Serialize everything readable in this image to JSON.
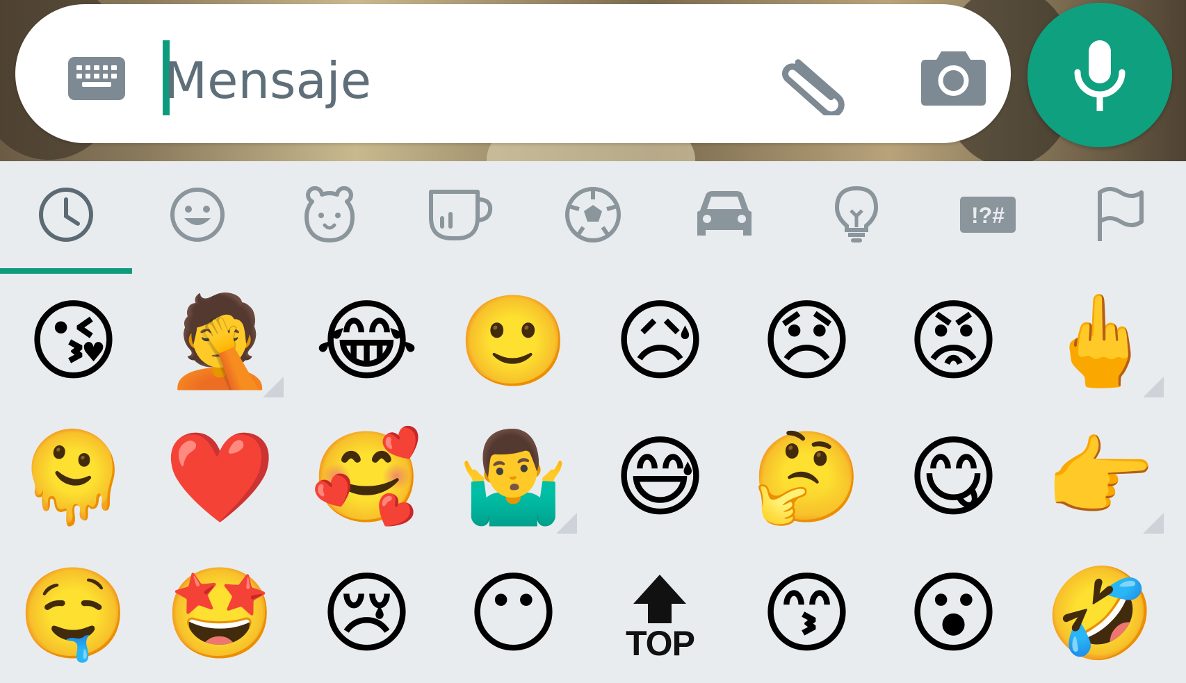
{
  "input": {
    "placeholder": "Mensaje",
    "value": ""
  },
  "icons": {
    "keyboard": "keyboard-icon",
    "attach": "paperclip-icon",
    "camera": "camera-icon",
    "mic": "microphone-icon"
  },
  "colors": {
    "accent": "#0d9b7e",
    "mic_bg": "#0fa07f",
    "icon_gray": "#6e7b84",
    "panel_bg": "#e9ecef"
  },
  "tabs": [
    {
      "name": "recent",
      "icon": "clock-icon",
      "selected": true
    },
    {
      "name": "smileys",
      "icon": "smiley-icon"
    },
    {
      "name": "animals",
      "icon": "bear-icon"
    },
    {
      "name": "food",
      "icon": "cup-icon"
    },
    {
      "name": "activity",
      "icon": "soccer-ball-icon"
    },
    {
      "name": "travel",
      "icon": "car-icon"
    },
    {
      "name": "objects",
      "icon": "lightbulb-icon"
    },
    {
      "name": "symbols",
      "icon": "symbols-icon",
      "label": "!?#"
    },
    {
      "name": "flags",
      "icon": "flag-icon"
    }
  ],
  "emojis": [
    {
      "char": "😘",
      "name": "face-blowing-kiss"
    },
    {
      "char": "🤦",
      "name": "person-facepalming",
      "variants": true
    },
    {
      "char": "😂",
      "name": "face-with-tears-of-joy"
    },
    {
      "char": "🙂",
      "name": "slightly-smiling-face"
    },
    {
      "char": "😥",
      "name": "sad-but-relieved-face"
    },
    {
      "char": "😞",
      "name": "disappointed-face"
    },
    {
      "char": "😡",
      "name": "pouting-face"
    },
    {
      "char": "🖕",
      "name": "middle-finger",
      "variants": true
    },
    {
      "char": "🫠",
      "name": "melting-face"
    },
    {
      "char": "❤️",
      "name": "red-heart"
    },
    {
      "char": "🥰",
      "name": "smiling-face-with-hearts"
    },
    {
      "char": "🤷‍♂️",
      "name": "man-shrugging",
      "variants": true
    },
    {
      "char": "😅",
      "name": "grinning-face-with-sweat"
    },
    {
      "char": "🤔",
      "name": "thinking-face"
    },
    {
      "char": "😋",
      "name": "face-savoring-food"
    },
    {
      "char": "👉",
      "name": "backhand-index-pointing-right",
      "variants": true
    },
    {
      "char": "🤤",
      "name": "drooling-face"
    },
    {
      "char": "🤩",
      "name": "star-struck"
    },
    {
      "char": "😢",
      "name": "crying-face"
    },
    {
      "char": "😶",
      "name": "face-without-mouth"
    },
    {
      "char": "",
      "name": "top-arrow",
      "label": "TOP"
    },
    {
      "char": "😙",
      "name": "kissing-face-with-smiling-eyes"
    },
    {
      "char": "😮",
      "name": "face-with-open-mouth"
    },
    {
      "char": "🤣",
      "name": "rolling-on-the-floor-laughing"
    }
  ]
}
